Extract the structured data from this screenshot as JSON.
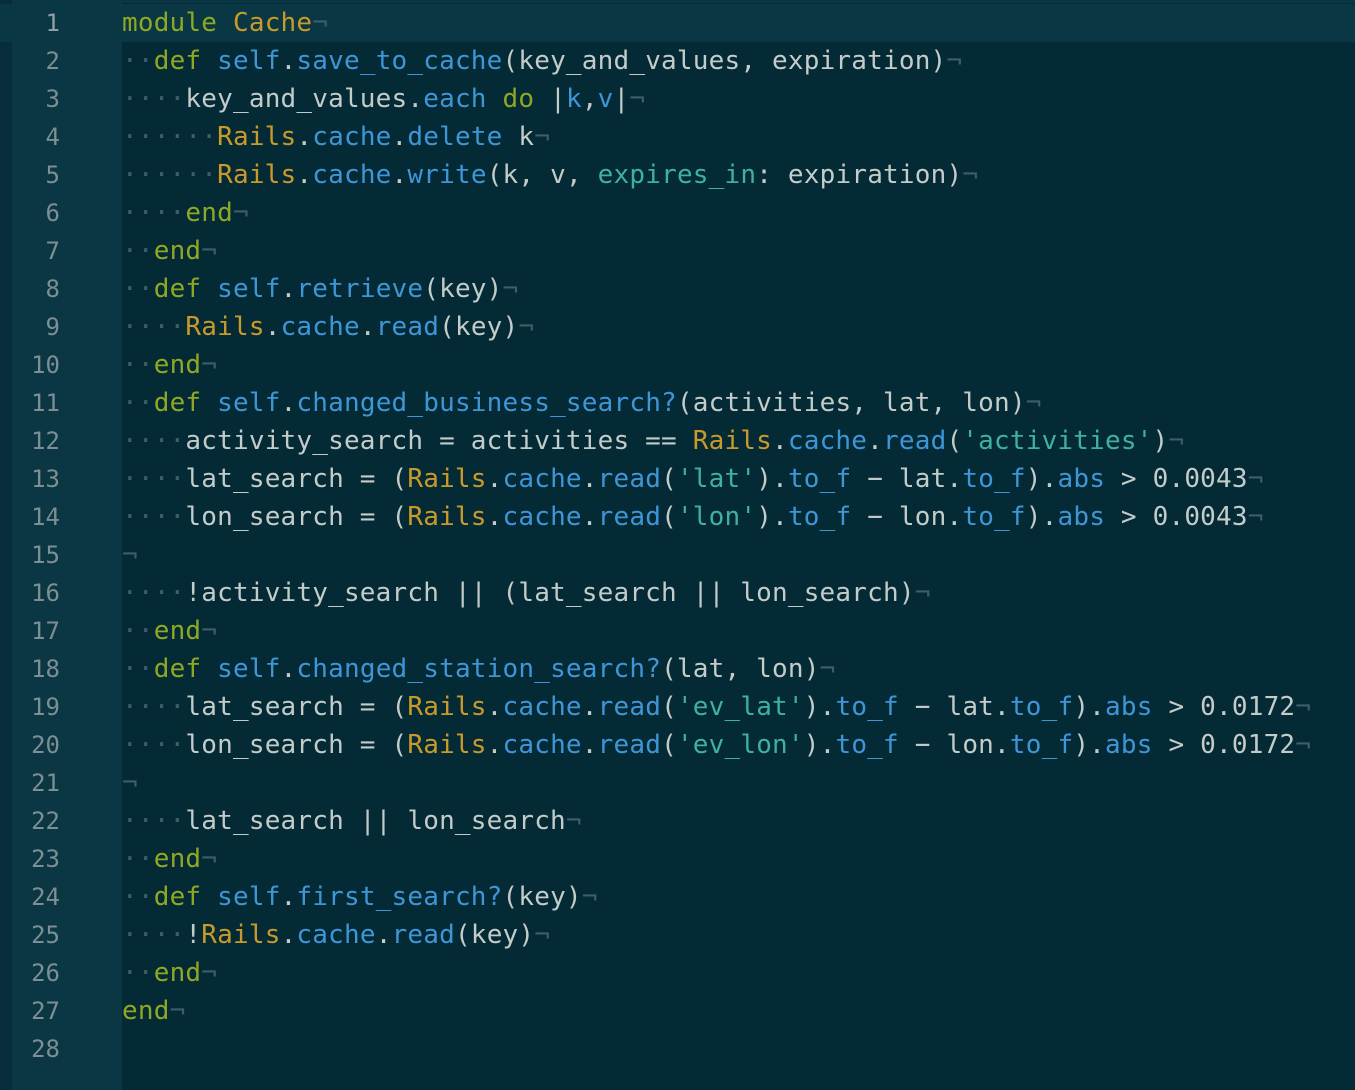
{
  "editor": {
    "language": "ruby",
    "current_line": 1,
    "lines": [
      {
        "n": "1",
        "tokens": [
          [
            "kw",
            "module"
          ],
          [
            "p",
            " "
          ],
          [
            "const",
            "Cache"
          ],
          [
            "eol",
            "¬"
          ]
        ]
      },
      {
        "n": "2",
        "tokens": [
          [
            "ws",
            "··"
          ],
          [
            "kw",
            "def"
          ],
          [
            "p",
            " "
          ],
          [
            "method",
            "self"
          ],
          [
            "p",
            "."
          ],
          [
            "method",
            "save_to_cache"
          ],
          [
            "p",
            "(key_and_values, expiration)"
          ],
          [
            "eol",
            "¬"
          ]
        ]
      },
      {
        "n": "3",
        "tokens": [
          [
            "ws",
            "····"
          ],
          [
            "p",
            "key_and_values."
          ],
          [
            "method",
            "each"
          ],
          [
            "p",
            " "
          ],
          [
            "kw",
            "do"
          ],
          [
            "p",
            " |"
          ],
          [
            "method",
            "k"
          ],
          [
            "p",
            ","
          ],
          [
            "method",
            "v"
          ],
          [
            "p",
            "|"
          ],
          [
            "eol",
            "¬"
          ]
        ]
      },
      {
        "n": "4",
        "tokens": [
          [
            "ws",
            "······"
          ],
          [
            "const",
            "Rails"
          ],
          [
            "p",
            "."
          ],
          [
            "method",
            "cache"
          ],
          [
            "p",
            "."
          ],
          [
            "method",
            "delete"
          ],
          [
            "p",
            " k"
          ],
          [
            "eol",
            "¬"
          ]
        ]
      },
      {
        "n": "5",
        "tokens": [
          [
            "ws",
            "······"
          ],
          [
            "const",
            "Rails"
          ],
          [
            "p",
            "."
          ],
          [
            "method",
            "cache"
          ],
          [
            "p",
            "."
          ],
          [
            "method",
            "write"
          ],
          [
            "p",
            "(k, v, "
          ],
          [
            "sym",
            "expires_in"
          ],
          [
            "p",
            ": expiration)"
          ],
          [
            "eol",
            "¬"
          ]
        ]
      },
      {
        "n": "6",
        "tokens": [
          [
            "ws",
            "····"
          ],
          [
            "kw",
            "end"
          ],
          [
            "eol",
            "¬"
          ]
        ]
      },
      {
        "n": "7",
        "tokens": [
          [
            "ws",
            "··"
          ],
          [
            "kw",
            "end"
          ],
          [
            "eol",
            "¬"
          ]
        ]
      },
      {
        "n": "8",
        "tokens": [
          [
            "ws",
            "··"
          ],
          [
            "kw",
            "def"
          ],
          [
            "p",
            " "
          ],
          [
            "method",
            "self"
          ],
          [
            "p",
            "."
          ],
          [
            "method",
            "retrieve"
          ],
          [
            "p",
            "(key)"
          ],
          [
            "eol",
            "¬"
          ]
        ]
      },
      {
        "n": "9",
        "tokens": [
          [
            "ws",
            "····"
          ],
          [
            "const",
            "Rails"
          ],
          [
            "p",
            "."
          ],
          [
            "method",
            "cache"
          ],
          [
            "p",
            "."
          ],
          [
            "method",
            "read"
          ],
          [
            "p",
            "(key)"
          ],
          [
            "eol",
            "¬"
          ]
        ]
      },
      {
        "n": "10",
        "tokens": [
          [
            "ws",
            "··"
          ],
          [
            "kw",
            "end"
          ],
          [
            "eol",
            "¬"
          ]
        ]
      },
      {
        "n": "11",
        "tokens": [
          [
            "ws",
            "··"
          ],
          [
            "kw",
            "def"
          ],
          [
            "p",
            " "
          ],
          [
            "method",
            "self"
          ],
          [
            "p",
            "."
          ],
          [
            "method",
            "changed_business_search?"
          ],
          [
            "p",
            "(activities, lat, lon)"
          ],
          [
            "eol",
            "¬"
          ]
        ]
      },
      {
        "n": "12",
        "tokens": [
          [
            "ws",
            "····"
          ],
          [
            "p",
            "activity_search = activities == "
          ],
          [
            "const",
            "Rails"
          ],
          [
            "p",
            "."
          ],
          [
            "method",
            "cache"
          ],
          [
            "p",
            "."
          ],
          [
            "method",
            "read"
          ],
          [
            "p",
            "("
          ],
          [
            "str",
            "'activities'"
          ],
          [
            "p",
            ")"
          ],
          [
            "eol",
            "¬"
          ]
        ]
      },
      {
        "n": "13",
        "tokens": [
          [
            "ws",
            "····"
          ],
          [
            "p",
            "lat_search = ("
          ],
          [
            "const",
            "Rails"
          ],
          [
            "p",
            "."
          ],
          [
            "method",
            "cache"
          ],
          [
            "p",
            "."
          ],
          [
            "method",
            "read"
          ],
          [
            "p",
            "("
          ],
          [
            "str",
            "'lat'"
          ],
          [
            "p",
            ")."
          ],
          [
            "method",
            "to_f"
          ],
          [
            "p",
            " − lat."
          ],
          [
            "method",
            "to_f"
          ],
          [
            "p",
            ")."
          ],
          [
            "method",
            "abs"
          ],
          [
            "p",
            " > 0.0043"
          ],
          [
            "eol",
            "¬"
          ]
        ]
      },
      {
        "n": "14",
        "tokens": [
          [
            "ws",
            "····"
          ],
          [
            "p",
            "lon_search = ("
          ],
          [
            "const",
            "Rails"
          ],
          [
            "p",
            "."
          ],
          [
            "method",
            "cache"
          ],
          [
            "p",
            "."
          ],
          [
            "method",
            "read"
          ],
          [
            "p",
            "("
          ],
          [
            "str",
            "'lon'"
          ],
          [
            "p",
            ")."
          ],
          [
            "method",
            "to_f"
          ],
          [
            "p",
            " − lon."
          ],
          [
            "method",
            "to_f"
          ],
          [
            "p",
            ")."
          ],
          [
            "method",
            "abs"
          ],
          [
            "p",
            " > 0.0043"
          ],
          [
            "eol",
            "¬"
          ]
        ]
      },
      {
        "n": "15",
        "tokens": [
          [
            "eol",
            "¬"
          ]
        ]
      },
      {
        "n": "16",
        "tokens": [
          [
            "ws",
            "····"
          ],
          [
            "p",
            "!activity_search || (lat_search || lon_search)"
          ],
          [
            "eol",
            "¬"
          ]
        ]
      },
      {
        "n": "17",
        "tokens": [
          [
            "ws",
            "··"
          ],
          [
            "kw",
            "end"
          ],
          [
            "eol",
            "¬"
          ]
        ]
      },
      {
        "n": "18",
        "tokens": [
          [
            "ws",
            "··"
          ],
          [
            "kw",
            "def"
          ],
          [
            "p",
            " "
          ],
          [
            "method",
            "self"
          ],
          [
            "p",
            "."
          ],
          [
            "method",
            "changed_station_search?"
          ],
          [
            "p",
            "(lat, lon)"
          ],
          [
            "eol",
            "¬"
          ]
        ]
      },
      {
        "n": "19",
        "tokens": [
          [
            "ws",
            "····"
          ],
          [
            "p",
            "lat_search = ("
          ],
          [
            "const",
            "Rails"
          ],
          [
            "p",
            "."
          ],
          [
            "method",
            "cache"
          ],
          [
            "p",
            "."
          ],
          [
            "method",
            "read"
          ],
          [
            "p",
            "("
          ],
          [
            "str",
            "'ev_lat'"
          ],
          [
            "p",
            ")."
          ],
          [
            "method",
            "to_f"
          ],
          [
            "p",
            " − lat."
          ],
          [
            "method",
            "to_f"
          ],
          [
            "p",
            ")."
          ],
          [
            "method",
            "abs"
          ],
          [
            "p",
            " > 0.0172"
          ],
          [
            "eol",
            "¬"
          ]
        ]
      },
      {
        "n": "20",
        "tokens": [
          [
            "ws",
            "····"
          ],
          [
            "p",
            "lon_search = ("
          ],
          [
            "const",
            "Rails"
          ],
          [
            "p",
            "."
          ],
          [
            "method",
            "cache"
          ],
          [
            "p",
            "."
          ],
          [
            "method",
            "read"
          ],
          [
            "p",
            "("
          ],
          [
            "str",
            "'ev_lon'"
          ],
          [
            "p",
            ")."
          ],
          [
            "method",
            "to_f"
          ],
          [
            "p",
            " − lon."
          ],
          [
            "method",
            "to_f"
          ],
          [
            "p",
            ")."
          ],
          [
            "method",
            "abs"
          ],
          [
            "p",
            " > 0.0172"
          ],
          [
            "eol",
            "¬"
          ]
        ]
      },
      {
        "n": "21",
        "tokens": [
          [
            "eol",
            "¬"
          ]
        ]
      },
      {
        "n": "22",
        "tokens": [
          [
            "ws",
            "····"
          ],
          [
            "p",
            "lat_search || lon_search"
          ],
          [
            "eol",
            "¬"
          ]
        ]
      },
      {
        "n": "23",
        "tokens": [
          [
            "ws",
            "··"
          ],
          [
            "kw",
            "end"
          ],
          [
            "eol",
            "¬"
          ]
        ]
      },
      {
        "n": "24",
        "tokens": [
          [
            "ws",
            "··"
          ],
          [
            "kw",
            "def"
          ],
          [
            "p",
            " "
          ],
          [
            "method",
            "self"
          ],
          [
            "p",
            "."
          ],
          [
            "method",
            "first_search?"
          ],
          [
            "p",
            "(key)"
          ],
          [
            "eol",
            "¬"
          ]
        ]
      },
      {
        "n": "25",
        "tokens": [
          [
            "ws",
            "····"
          ],
          [
            "p",
            "!"
          ],
          [
            "const",
            "Rails"
          ],
          [
            "p",
            "."
          ],
          [
            "method",
            "cache"
          ],
          [
            "p",
            "."
          ],
          [
            "method",
            "read"
          ],
          [
            "p",
            "(key)"
          ],
          [
            "eol",
            "¬"
          ]
        ]
      },
      {
        "n": "26",
        "tokens": [
          [
            "ws",
            "··"
          ],
          [
            "kw",
            "end"
          ],
          [
            "eol",
            "¬"
          ]
        ]
      },
      {
        "n": "27",
        "tokens": [
          [
            "kw",
            "end"
          ],
          [
            "eol",
            "¬"
          ]
        ]
      },
      {
        "n": "28",
        "tokens": []
      }
    ]
  },
  "colors": {
    "background": "#042a36",
    "gutter": "#0b3643",
    "keyword": "#8fa823",
    "constant": "#c99a2a",
    "method": "#3f96d6",
    "string": "#3fb0a2",
    "plain": "#c3ccc8",
    "invisible": "#3d5f68",
    "line_number": "#7b8f94"
  }
}
